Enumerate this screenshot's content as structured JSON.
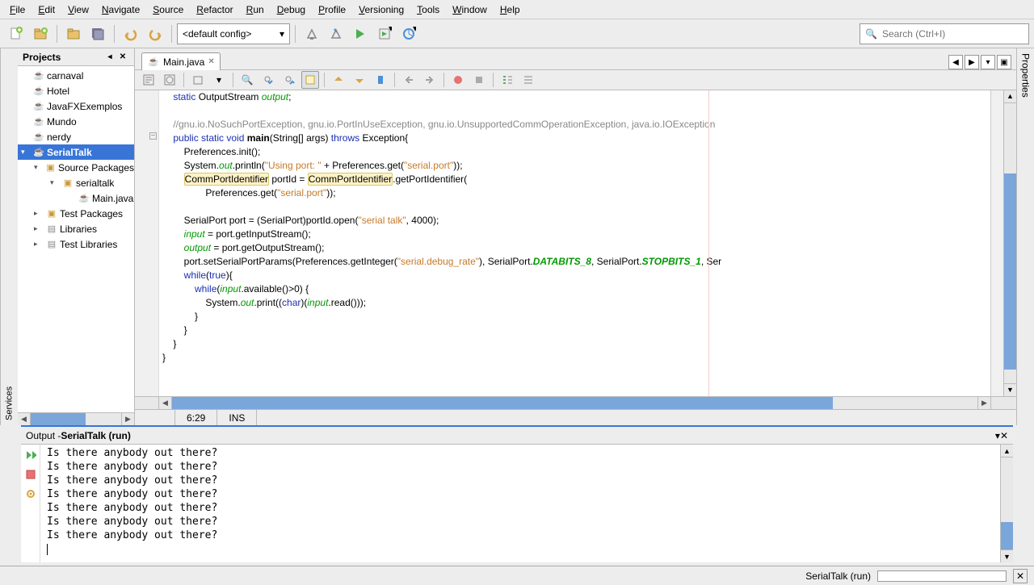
{
  "menu": [
    "File",
    "Edit",
    "View",
    "Navigate",
    "Source",
    "Refactor",
    "Run",
    "Debug",
    "Profile",
    "Versioning",
    "Tools",
    "Window",
    "Help"
  ],
  "config": {
    "selected": "<default config>"
  },
  "search": {
    "placeholder": "Search (Ctrl+I)"
  },
  "sidebarLeft": "Services",
  "sidebarRight": "Properties",
  "projects": {
    "title": "Projects",
    "items": [
      {
        "label": "carnaval",
        "lvl": 0,
        "icon": "java"
      },
      {
        "label": "Hotel",
        "lvl": 0,
        "icon": "java"
      },
      {
        "label": "JavaFXExemplos",
        "lvl": 0,
        "icon": "java"
      },
      {
        "label": "Mundo",
        "lvl": 0,
        "icon": "java"
      },
      {
        "label": "nerdy",
        "lvl": 0,
        "icon": "java"
      },
      {
        "label": "SerialTalk",
        "lvl": 0,
        "icon": "java",
        "selected": true,
        "open": true
      },
      {
        "label": "Source Packages",
        "lvl": 1,
        "icon": "pkg",
        "open": true,
        "twisty": "open"
      },
      {
        "label": "serialtalk",
        "lvl": 2,
        "icon": "pkg",
        "open": true,
        "twisty": "open"
      },
      {
        "label": "Main.java",
        "lvl": 3,
        "icon": "java"
      },
      {
        "label": "Test Packages",
        "lvl": 1,
        "icon": "pkg",
        "twisty": "closed"
      },
      {
        "label": "Libraries",
        "lvl": 1,
        "icon": "lib",
        "twisty": "closed"
      },
      {
        "label": "Test Libraries",
        "lvl": 1,
        "icon": "lib",
        "twisty": "closed"
      }
    ]
  },
  "editor": {
    "tab": {
      "name": "Main.java"
    },
    "statusPos": "6:29",
    "statusMode": "INS",
    "code_html": "    <span class='kw'>static</span> OutputStream <span class='fld'>output</span>;\n\n    <span class='cmt'>//gnu.io.NoSuchPortException, gnu.io.PortInUseException, gnu.io.UnsupportedCommOperationException, java.io.IOException</span>\n    <span class='kw'>public static void</span> <span class='mth'>main</span>(String[] args) <span class='kw'>throws</span> Exception{\n        Preferences.init();\n        System.<span class='fld'>out</span>.println(<span class='str'>\"Using port: \"</span> + Preferences.get(<span class='str'>\"serial.port\"</span>));\n        <span class='hl'>CommPortIdentifier</span> portId = <span class='hl'>CommPortIdentifier</span>.getPortIdentifier(\n                Preferences.get(<span class='str'>\"serial.port\"</span>));\n\n        SerialPort port = (SerialPort)portId.open(<span class='str'>\"serial talk\"</span>, 4000);\n        <span class='fld'>input</span> = port.getInputStream();\n        <span class='fld'>output</span> = port.getOutputStream();\n        port.setSerialPortParams(Preferences.getInteger(<span class='str'>\"serial.debug_rate\"</span>), SerialPort.<span class='static-const'>DATABITS_8</span>, SerialPort.<span class='static-const'>STOPBITS_1</span>, Ser\n        <span class='kw'>while</span>(<span class='kw'>true</span>){\n            <span class='kw'>while</span>(<span class='fld'>input</span>.available()>0) {\n                System.<span class='fld'>out</span>.print((<span class='kw'>char</span>)(<span class='fld'>input</span>.read()));\n            }\n        }\n    }\n}\n"
  },
  "output": {
    "titlePrefix": "Output - ",
    "titleName": "SerialTalk (run)",
    "lines": [
      "Is there anybody out there?",
      "Is there anybody out there?",
      "Is there anybody out there?",
      "Is there anybody out there?",
      "Is there anybody out there?",
      "Is there anybody out there?",
      "Is there anybody out there?"
    ]
  },
  "runStatus": {
    "label": "SerialTalk (run)"
  }
}
